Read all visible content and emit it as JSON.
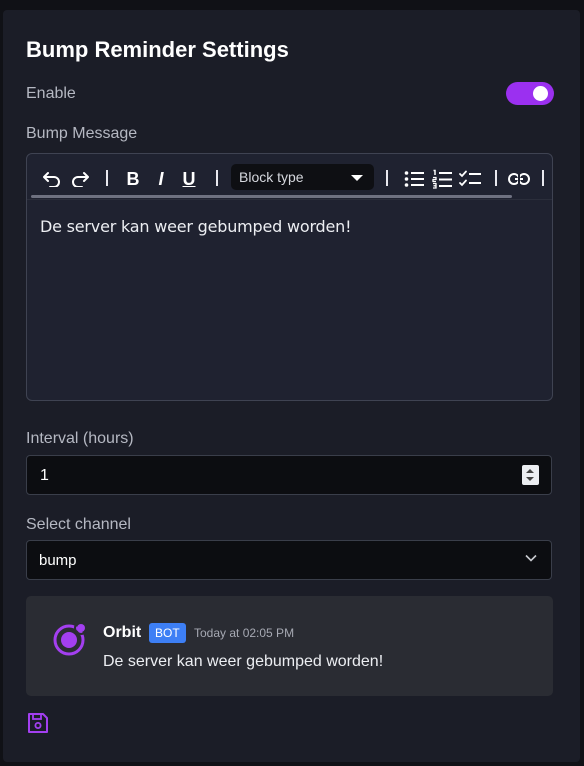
{
  "settings": {
    "title": "Bump Reminder Settings",
    "enable_label": "Enable",
    "enabled": true,
    "message_label": "Bump Message",
    "interval_label": "Interval (hours)",
    "interval_value": "1",
    "channel_label": "Select channel",
    "channel_value": "bump"
  },
  "editor": {
    "toolbar": {
      "bold": "B",
      "italic": "I",
      "underline": "U",
      "block_type_placeholder": "Block type"
    },
    "content": "De server kan weer gebumped worden!"
  },
  "preview": {
    "bot_name": "Orbit",
    "badge": "BOT",
    "timestamp": "Today at 02:05 PM",
    "message": "De server kan weer gebumped worden!"
  },
  "icons": {
    "undo": "undo-icon",
    "redo": "redo-icon",
    "bullet_list": "bullet-list-icon",
    "numbered_list": "numbered-list-icon",
    "check_list": "check-list-icon",
    "link": "link-icon",
    "save": "save-icon",
    "avatar": "orbit-logo-icon"
  },
  "colors": {
    "accent": "#9b30f0",
    "background": "#1b1d27",
    "badge": "#3d7ff5"
  }
}
